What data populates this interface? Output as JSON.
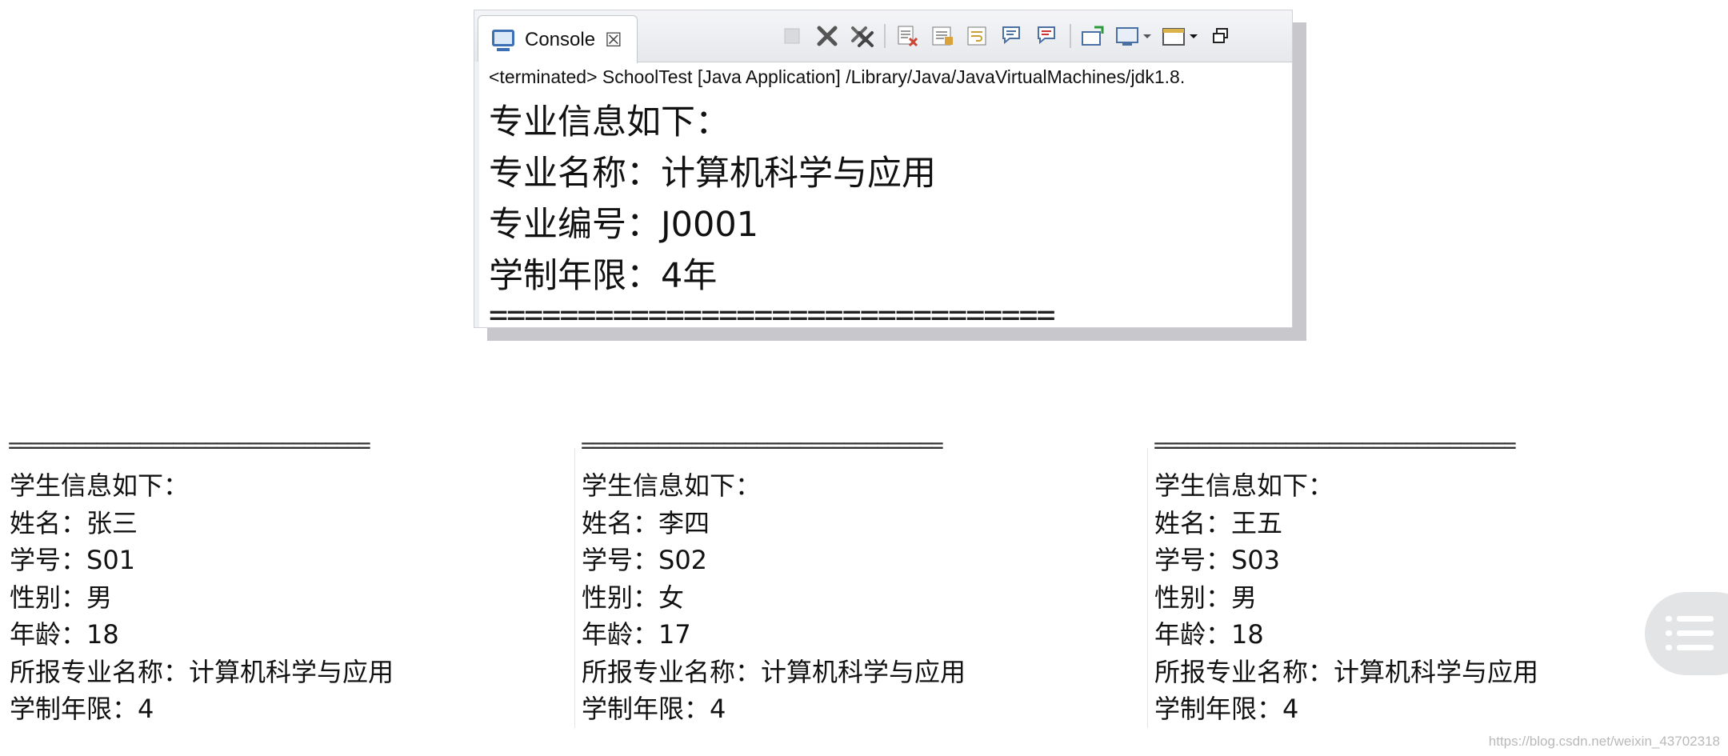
{
  "console": {
    "tab_label": "Console",
    "tab_close": "☒",
    "path_line": "<terminated> SchoolTest [Java Application] /Library/Java/JavaVirtualMachines/jdk1.8.",
    "lines": [
      "专业信息如下：",
      "专业名称：计算机科学与应用",
      "专业编号：J0001",
      "学制年限：4年"
    ],
    "separator": "================================"
  },
  "toolbar_icons": [
    "terminate-icon",
    "remove-launch-icon",
    "remove-all-terminated-icon",
    "clear-console-icon",
    "scroll-lock-icon",
    "word-wrap-icon",
    "show-on-stdout-icon",
    "show-on-stderr-icon",
    "pin-console-icon",
    "display-selected-console-icon",
    "open-console-icon",
    "maximize-icon"
  ],
  "output": {
    "separators": [
      "=================================",
      "=================================",
      "================================="
    ],
    "students": [
      {
        "header": "学生信息如下：",
        "name": "姓名：张三",
        "id": "学号：S01",
        "gender": "性别：男",
        "age": "年龄：18",
        "major": "所报专业名称：计算机科学与应用",
        "years": "学制年限：4"
      },
      {
        "header": "学生信息如下：",
        "name": "姓名：李四",
        "id": "学号：S02",
        "gender": "性别：女",
        "age": "年龄：17",
        "major": "所报专业名称：计算机科学与应用",
        "years": "学制年限：4"
      },
      {
        "header": "学生信息如下：",
        "name": "姓名：王五",
        "id": "学号：S03",
        "gender": "性别：男",
        "age": "年龄：18",
        "major": "所报专业名称：计算机科学与应用",
        "years": "学制年限：4"
      }
    ]
  },
  "watermark": "https://blog.csdn.net/weixin_43702318",
  "colors": {
    "toolbar_bg": "#e6e8ec",
    "window_shadow": "#c8c8cc",
    "fab_bg": "#e3e4e6"
  }
}
